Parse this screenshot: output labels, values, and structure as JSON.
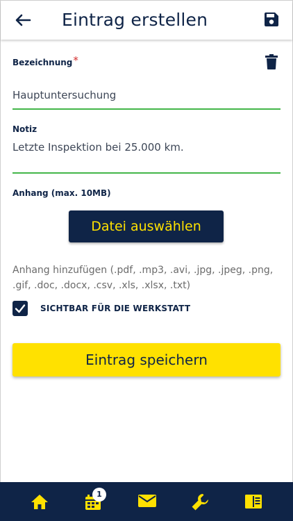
{
  "header": {
    "title": "Eintrag erstellen",
    "back_icon": "arrow-left-icon",
    "save_icon": "floppy-disk-icon"
  },
  "form": {
    "name_label": "Bezeichnung",
    "required_marker": "*",
    "name_value": "Hauptuntersuchung",
    "delete_icon": "trash-icon",
    "note_label": "Notiz",
    "note_value": "Letzte Inspektion bei 25.000 km.",
    "attachment_label": "Anhang (max. 10MB)",
    "choose_file_label": "Datei auswählen",
    "attachment_hint": "Anhang hinzufügen (.pdf, .mp3, .avi, .jpg, .jpeg, .png, .gif, .doc, .docx, .csv, .xls, .xlsx, .txt)",
    "visibility_label": "SICHTBAR FÜR DIE WERKSTATT",
    "visibility_checked": true,
    "save_label": "Eintrag speichern"
  },
  "bottom_nav": {
    "items": [
      {
        "icon": "home-icon"
      },
      {
        "icon": "calendar-icon",
        "badge": "1"
      },
      {
        "icon": "mail-icon"
      },
      {
        "icon": "wrench-icon"
      },
      {
        "icon": "book-icon"
      }
    ]
  },
  "colors": {
    "navy": "#0f2447",
    "yellow": "#ffe100",
    "green_underline": "#43b649",
    "required_red": "#d32f2f"
  }
}
